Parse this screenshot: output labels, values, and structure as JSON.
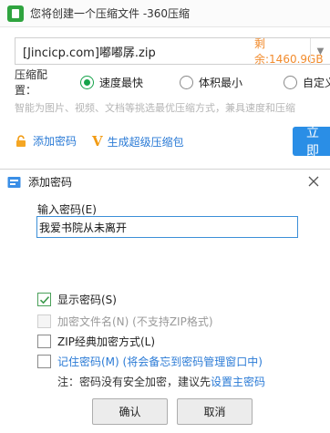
{
  "bg_window": {
    "title": "您将创建一个压缩文件 -360压缩",
    "path": "[Jincicp.com]嘟嘟孱.zip",
    "remaining": "剩余:1460.9GB",
    "config_label": "压缩配置：",
    "options": [
      "速度最快",
      "体积最小",
      "自定义"
    ],
    "selected_option": "速度最快",
    "hint": "智能为图片、视频、文档等挑选最优压缩方式，兼具速度和压缩",
    "add_password": "添加密码",
    "super_pack": "生成超级压缩包",
    "now_button": "立即"
  },
  "dialog": {
    "title": "添加密码",
    "input_label": "输入密码(E)",
    "password_value": "我爱书院从未离开",
    "checks": [
      {
        "label": "显示密码(S)",
        "checked": true,
        "disabled": false,
        "style": "normal"
      },
      {
        "label": "加密文件名(N) (不支持ZIP格式)",
        "checked": false,
        "disabled": true,
        "style": "disabled"
      },
      {
        "label": "ZIP经典加密方式(L)",
        "checked": false,
        "disabled": false,
        "style": "normal"
      },
      {
        "label": "记住密码(M) (将会备忘到密码管理窗口中)",
        "checked": false,
        "disabled": false,
        "style": "blue"
      }
    ],
    "note_prefix": "注：密码没有安全加密，建议先",
    "note_link": "设置主密码",
    "ok_label": "确认",
    "cancel_label": "取消"
  },
  "colors": {
    "accent_blue": "#2b7bd6",
    "radio_green": "#16a34a",
    "remaining_orange": "#f28b2c",
    "primary_button": "#2a8ee6"
  }
}
